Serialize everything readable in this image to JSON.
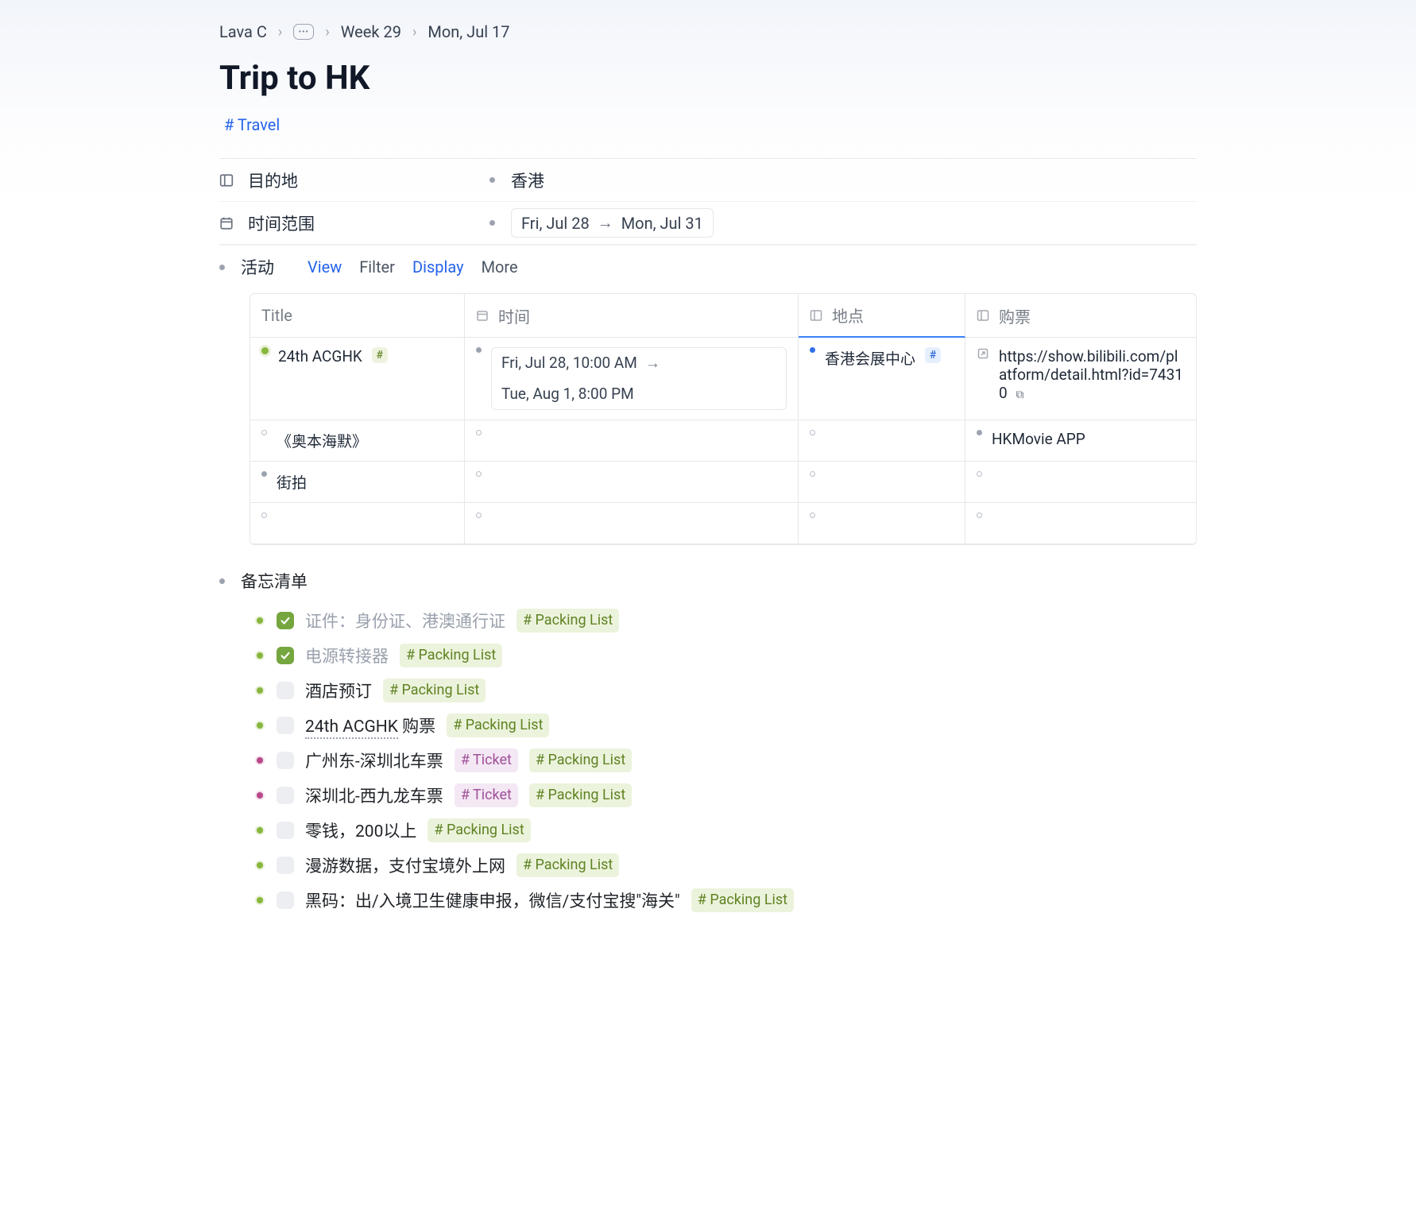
{
  "breadcrumb": {
    "root": "Lava C",
    "week": "Week 29",
    "date": "Mon, Jul 17"
  },
  "page": {
    "title": "Trip to HK",
    "tag": "# Travel"
  },
  "props": {
    "destination_label": "目的地",
    "destination_value": "香港",
    "daterange_label": "时间范围",
    "daterange_from": "Fri, Jul 28",
    "daterange_to": "Mon, Jul 31"
  },
  "activities": {
    "label": "活动",
    "view": "View",
    "filter": "Filter",
    "display": "Display",
    "more": "More",
    "columns": {
      "title": "Title",
      "time": "时间",
      "place": "地点",
      "ticket": "购票"
    },
    "rows": [
      {
        "title": "24th ACGHK",
        "time_from": "Fri, Jul 28, 10:00 AM",
        "time_to": "Tue, Aug 1, 8:00 PM",
        "place": "香港会展中心",
        "ticket": "https://show.bilibili.com/platform/detail.html?id=74310",
        "title_dot": "green",
        "title_hash": true,
        "place_dot": "blue",
        "place_hash": true,
        "ticket_link": true
      },
      {
        "title": "《奥本海默》",
        "time_from": "",
        "time_to": "",
        "place": "",
        "ticket": "HKMovie APP",
        "title_dot": "ring",
        "ticket_dot": "grey"
      },
      {
        "title": "街拍",
        "time_from": "",
        "time_to": "",
        "place": "",
        "ticket": "",
        "title_dot": "grey"
      },
      {
        "title": "",
        "time_from": "",
        "time_to": "",
        "place": "",
        "ticket": ""
      }
    ]
  },
  "checklist": {
    "label": "备忘清单",
    "packing_tag": "# Packing List",
    "ticket_tag": "# Ticket",
    "items": [
      {
        "done": true,
        "bullet": "green",
        "text": "证件：身份证、港澳通行证",
        "tags": [
          "packing"
        ]
      },
      {
        "done": true,
        "bullet": "green",
        "text": "电源转接器",
        "tags": [
          "packing"
        ]
      },
      {
        "done": false,
        "bullet": "green",
        "text": "酒店预订",
        "tags": [
          "packing"
        ]
      },
      {
        "done": false,
        "bullet": "green",
        "text_link": "24th ACGHK",
        "text_suffix": " 购票",
        "tags": [
          "packing"
        ]
      },
      {
        "done": false,
        "bullet": "pink",
        "text": "广州东-深圳北车票",
        "tags": [
          "ticket",
          "packing"
        ]
      },
      {
        "done": false,
        "bullet": "pink",
        "text": "深圳北-西九龙车票",
        "tags": [
          "ticket",
          "packing"
        ]
      },
      {
        "done": false,
        "bullet": "green",
        "text": "零钱，200以上",
        "tags": [
          "packing"
        ]
      },
      {
        "done": false,
        "bullet": "green",
        "text": "漫游数据，支付宝境外上网",
        "tags": [
          "packing"
        ]
      },
      {
        "done": false,
        "bullet": "green",
        "text": "黑码：出/入境卫生健康申报，微信/支付宝搜\"海关\"",
        "tags": [
          "packing"
        ]
      }
    ]
  }
}
